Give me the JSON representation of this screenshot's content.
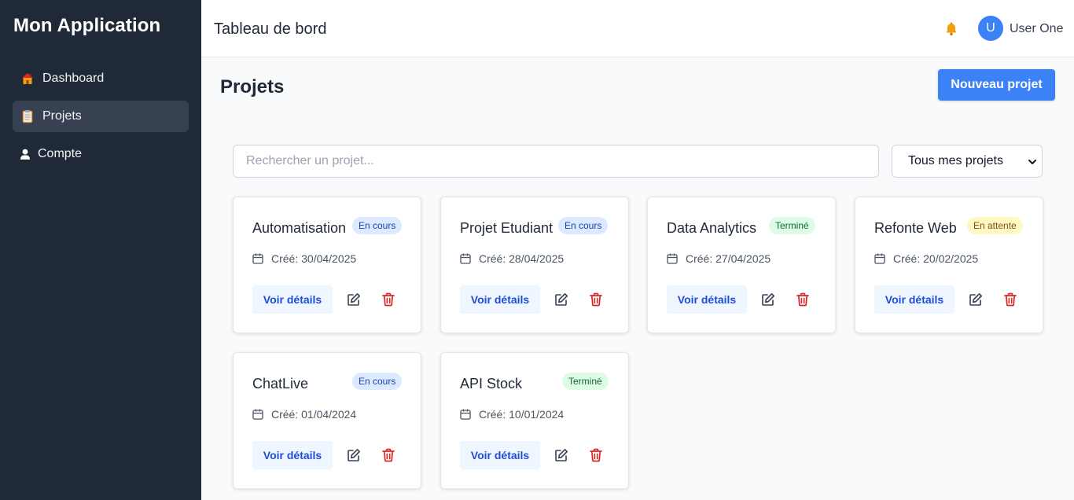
{
  "app": {
    "title": "Mon Application"
  },
  "sidebar": {
    "items": [
      {
        "label": "Dashboard",
        "icon": "house-icon"
      },
      {
        "label": "Projets",
        "icon": "clipboard-icon",
        "active": true
      },
      {
        "label": "Compte",
        "icon": "user-icon"
      }
    ]
  },
  "header": {
    "title": "Tableau de bord",
    "user_initial": "U",
    "user_name": "User One"
  },
  "main": {
    "title": "Projets",
    "new_button": "Nouveau projet",
    "search_placeholder": "Rechercher un projet...",
    "filter_value": "Tous mes projets"
  },
  "colors": {
    "sidebar": "#1f2937",
    "accent": "#3b82f6",
    "danger": "#dc2626"
  },
  "projects": [
    {
      "name": "Automatisation",
      "status": "En cours",
      "created": "Créé: 30/04/2025",
      "view": "Voir détails"
    },
    {
      "name": "Projet Etudiant",
      "status": "En cours",
      "created": "Créé: 28/04/2025",
      "view": "Voir détails"
    },
    {
      "name": "Data Analytics",
      "status": "Terminé",
      "created": "Créé: 27/04/2025",
      "view": "Voir détails"
    },
    {
      "name": "Refonte Web",
      "status": "En attente",
      "created": "Créé: 20/02/2025",
      "view": "Voir détails"
    },
    {
      "name": "ChatLive",
      "status": "En cours",
      "created": "Créé: 01/04/2024",
      "view": "Voir détails"
    },
    {
      "name": "API Stock",
      "status": "Terminé",
      "created": "Créé: 10/01/2024",
      "view": "Voir détails"
    }
  ]
}
